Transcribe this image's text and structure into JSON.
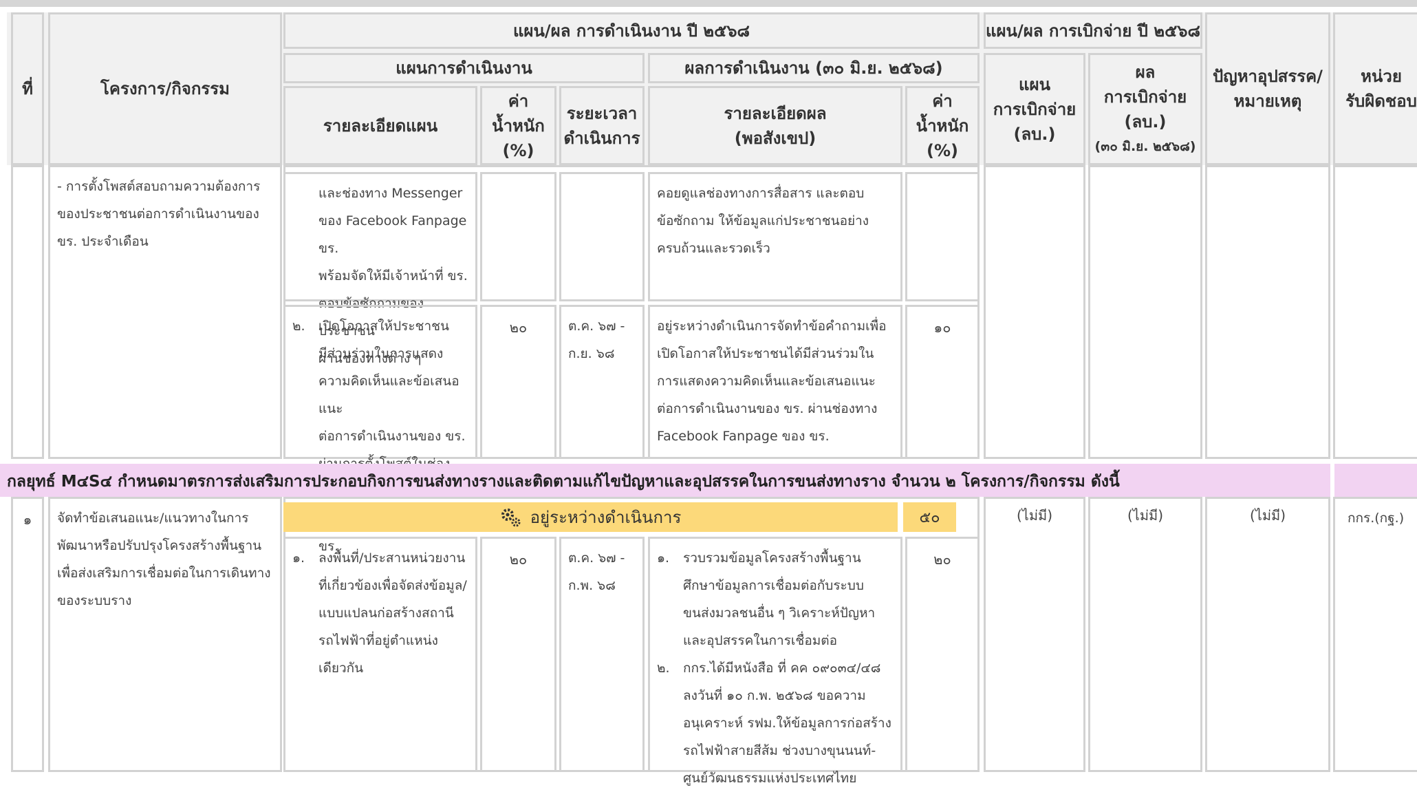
{
  "header": {
    "col_no": "ที่",
    "col_project": "โครงการ/กิจกรรม",
    "op_title": "แผน/ผล การดำเนินงาน ปี ๒๕๖๘",
    "plan_title": "แผนการดำเนินงาน",
    "plan_detail": "รายละเอียดแผน",
    "weight_line1": "ค่า",
    "weight_line2": "น้ำหนัก",
    "weight_line3": "(%)",
    "duration_line1": "ระยะเวลา",
    "duration_line2": "ดำเนินการ",
    "result_title": "ผลการดำเนินงาน (๓๐ มิ.ย. ๒๕๖๘)",
    "result_detail_line1": "รายละเอียดผล",
    "result_detail_line2": "(พอสังเขป)",
    "budget_title": "แผน/ผล การเบิกจ่าย ปี ๒๕๖๘",
    "budget_plan_line1": "แผน",
    "budget_plan_line2": "การเบิกจ่าย",
    "budget_plan_line3": "(ลบ.)",
    "budget_result_line1": "ผล",
    "budget_result_line2": "การเบิกจ่าย",
    "budget_result_line3": "(ลบ.)",
    "budget_result_line4": "(๓๐ มิ.ย. ๒๕๖๘)",
    "problem_line1": "ปัญหาอุปสรรค/",
    "problem_line2": "หมายเหตุ",
    "resp_line1": "หน่วย",
    "resp_line2": "รับผิดชอบ"
  },
  "block1": {
    "project_lines": [
      "- การตั้งโพสต์สอบถามความต้องการ",
      "ของประชาชนต่อการดำเนินงานของ",
      "ขร. ประจำเดือน"
    ],
    "plan_row1": {
      "detail_lines": [
        "และช่องทาง Messenger",
        "ของ Facebook Fanpage ขร.",
        "พร้อมจัดให้มีเจ้าหน้าที่ ขร.",
        "ตอบข้อซักถามของประชาชน",
        "ผ่านช่องทางต่าง ๆ"
      ],
      "result_lines": [
        "คอยดูแลช่องทางการสื่อสาร และตอบ",
        "ข้อซักถาม ให้ข้อมูลแก่ประชาชนอย่าง",
        "ครบถ้วนและรวดเร็ว"
      ]
    },
    "plan_row2": {
      "number": "๒.",
      "detail_lines": [
        "เปิดโอกาสให้ประชาชน",
        "มีส่วนร่วมในการแสดง",
        "ความคิดเห็นและข้อเสนอแนะ",
        "ต่อการดำเนินงานของ ขร.",
        "ผ่านการตั้งโพสต์ในช่องทาง",
        "Facebook Fanpage ของ ขร."
      ],
      "weight": "๒๐",
      "duration_lines": [
        "ต.ค. ๖๗ -",
        "ก.ย. ๖๘"
      ],
      "result_lines": [
        "อยู่ระหว่างดำเนินการจัดทำข้อคำถามเพื่อ",
        "เปิดโอกาสให้ประชาชนได้มีส่วนร่วมใน",
        "การแสดงความคิดเห็นและข้อเสนอแนะ",
        "ต่อการดำเนินงานของ ขร. ผ่านช่องทาง",
        "Facebook Fanpage ของ ขร."
      ],
      "result_weight": "๑๐"
    }
  },
  "section": {
    "title": "กลยุทธ์ M๔S๔ กำหนดมาตรการส่งเสริมการประกอบกิจการขนส่งทางรางและติดตามแก้ไขปัญหาและอุปสรรคในการขนส่งทางราง จำนวน ๒ โครงการ/กิจกรรม ดังนี้"
  },
  "block2": {
    "number": "๑",
    "project_lines": [
      "จัดทำข้อเสนอแนะ/แนวทางในการ",
      "พัฒนาหรือปรับปรุงโครงสร้างพื้นฐาน",
      "เพื่อส่งเสริมการเชื่อมต่อในการเดินทาง",
      "ของระบบราง"
    ],
    "status": "อยู่ระหว่างดำเนินการ",
    "status_weight": "๕๐",
    "budget_plan": "(ไม่มี)",
    "budget_result": "(ไม่มี)",
    "problem": "(ไม่มี)",
    "responsible": "กกร.(กฐ.)",
    "plan_row1": {
      "number": "๑.",
      "detail_lines": [
        "ลงพื้นที่/ประสานหน่วยงาน",
        "ที่เกี่ยวข้องเพื่อจัดส่งข้อมูล/",
        "แบบแปลนก่อสร้างสถานี",
        "รถไฟฟ้าที่อยู่ตำแหน่ง",
        "เดียวกัน"
      ],
      "weight": "๒๐",
      "duration_lines": [
        "ต.ค. ๖๗ -",
        "ก.พ. ๖๘"
      ],
      "result_items": [
        {
          "num": "๑.",
          "lines": [
            "รวบรวมข้อมูลโครงสร้างพื้นฐาน",
            "ศึกษาข้อมูลการเชื่อมต่อกับระบบ",
            "ขนส่งมวลชนอื่น ๆ วิเคราะห์ปัญหา",
            "และอุปสรรคในการเชื่อมต่อ"
          ]
        },
        {
          "num": "๒.",
          "lines": [
            "กกร.ได้มีหนังสือ ที่ คค ๐๙๐๓๔/๔๘",
            "ลงวันที่ ๑๐ ก.พ. ๒๕๖๘ ขอความ",
            "อนุเคราะห์ รฟม.ให้ข้อมูลการก่อสร้าง",
            "รถไฟฟ้าสายสีส้ม ช่วงบางขุนนนท์-",
            "ศูนย์วัฒนธรรมแห่งประเทศไทย"
          ]
        }
      ],
      "result_weight": "๒๐"
    }
  },
  "colors": {
    "section_bg": "#f2d3f2",
    "status_bg": "#fcd97a",
    "header_bg": "#f1f1f1",
    "grid": "#d2d2d2"
  },
  "icons": {
    "status": "gear-icon"
  }
}
